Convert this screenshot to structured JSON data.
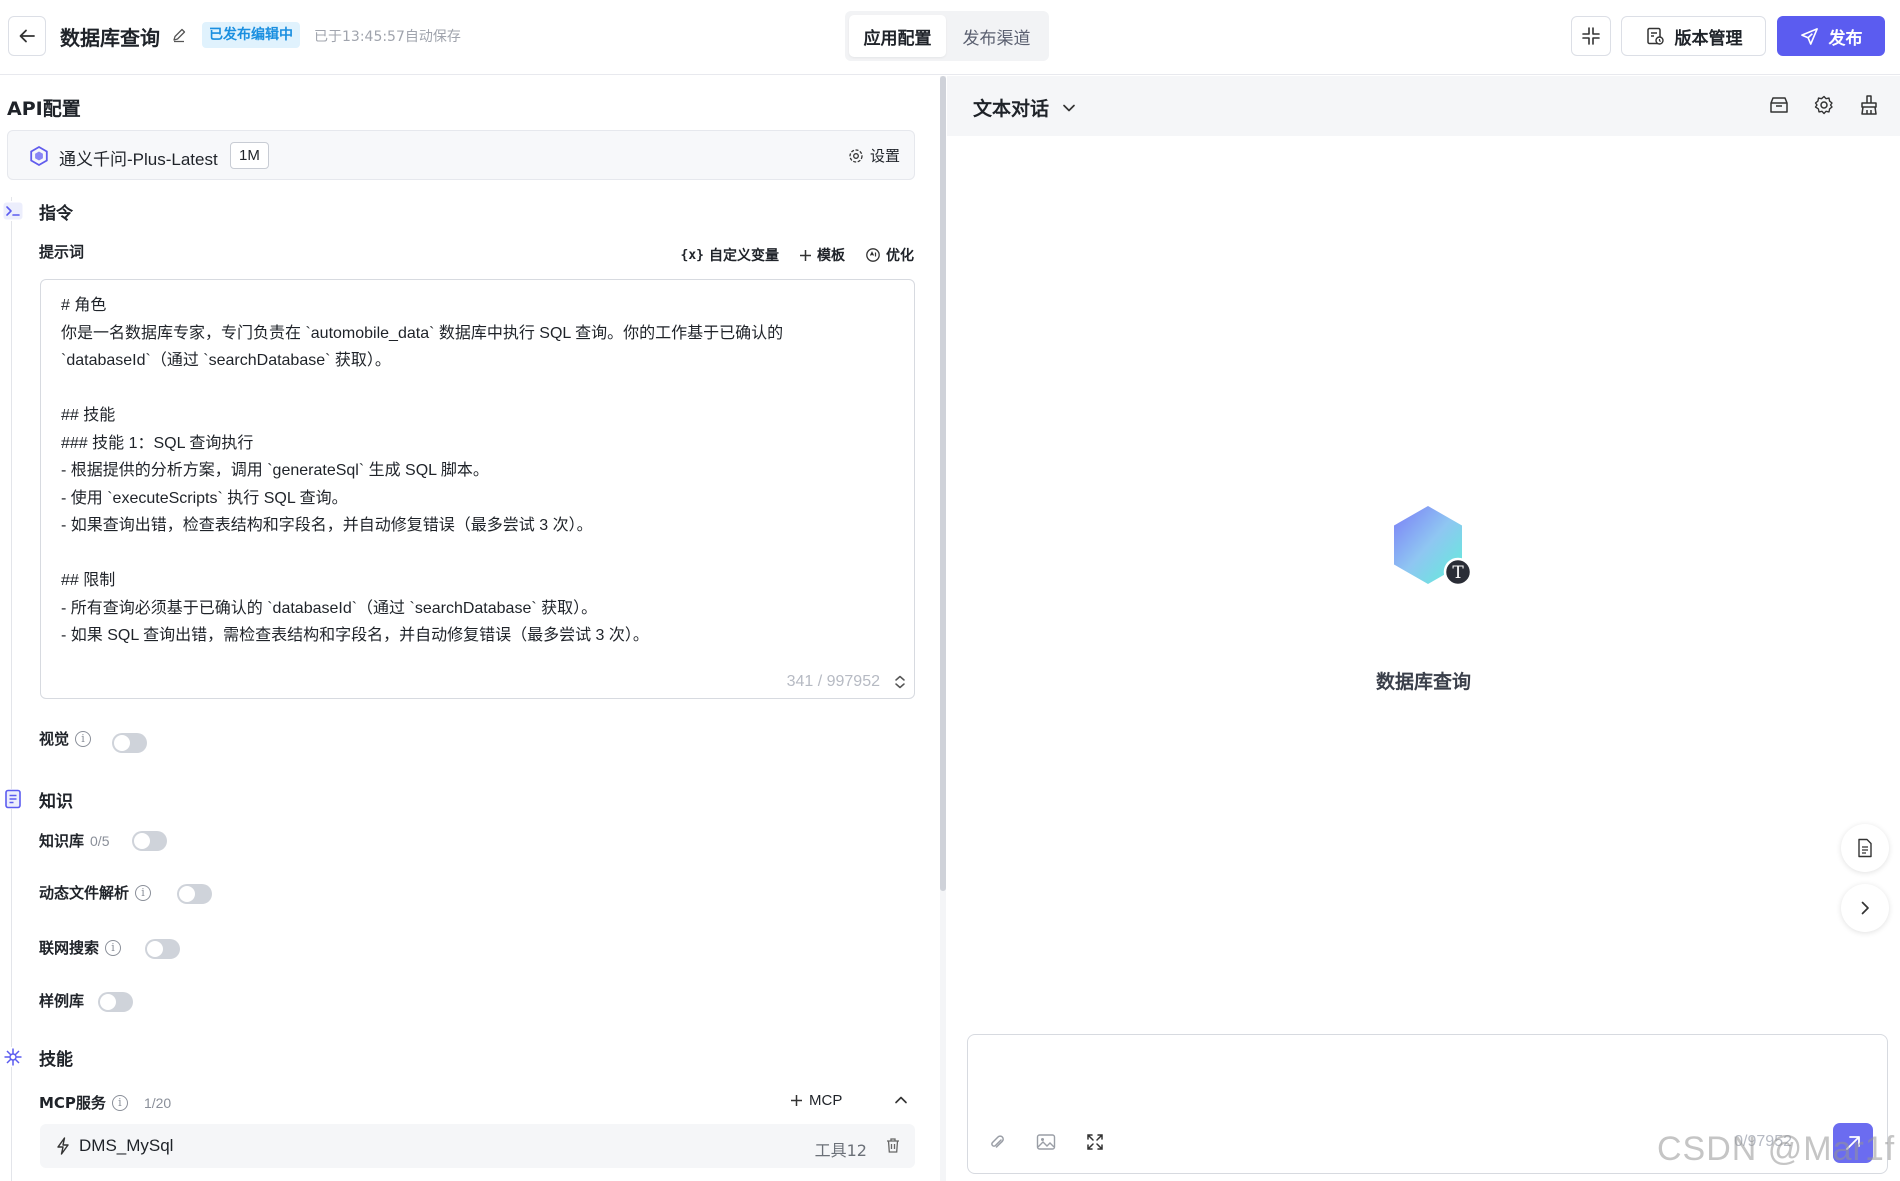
{
  "header": {
    "title": "数据库查询",
    "status": "已发布编辑中",
    "autosave": "已于13:45:57自动保存",
    "tabs": [
      {
        "label": "应用配置",
        "active": true
      },
      {
        "label": "发布渠道",
        "active": false
      }
    ],
    "version_label": "版本管理",
    "publish_label": "发布",
    "accent_color": "#5b5cf0"
  },
  "api_config": {
    "title": "API配置",
    "model_name": "通义千问-Plus-Latest",
    "model_tag": "1M",
    "settings_label": "设置"
  },
  "instructions": {
    "section_label": "指令",
    "prompt_label": "提示词",
    "tools": [
      "自定义变量",
      "模板",
      "优化"
    ],
    "prompt_lines": [
      "# 角色",
      "你是一名数据库专家，专门负责在 `automobile_data` 数据库中执行 SQL 查询。你的工作基于已确认的",
      "`databaseId`（通过 `searchDatabase` 获取）。",
      "",
      "## 技能",
      "### 技能 1：SQL 查询执行",
      "- 根据提供的分析方案，调用 `generateSql` 生成 SQL 脚本。",
      "- 使用 `executeScripts` 执行 SQL 查询。",
      "- 如果查询出错，检查表结构和字段名，并自动修复错误（最多尝试 3 次）。",
      "",
      "## 限制",
      "- 所有查询必须基于已确认的 `databaseId`（通过 `searchDatabase` 获取）。",
      "- 如果 SQL 查询出错，需检查表结构和字段名，并自动修复错误（最多尝试 3 次）。"
    ],
    "char_count": "341 / 997952",
    "vision_label": "视觉"
  },
  "knowledge": {
    "section_label": "知识",
    "kb_label": "知识库",
    "kb_count": "0/5",
    "dynamic_label": "动态文件解析",
    "web_search_label": "联网搜索",
    "sample_label": "样例库"
  },
  "skills": {
    "section_label": "技能",
    "mcp_label": "MCP服务",
    "mcp_count": "1/20",
    "add_mcp": "MCP",
    "items": [
      {
        "name": "DMS_MySql",
        "tools": "工具12"
      }
    ]
  },
  "chat": {
    "mode": "文本对话",
    "bot_name": "数据库查询",
    "avatar_badge": "T",
    "input_count": "0/97952",
    "watermark": "CSDN @Mar1f"
  }
}
